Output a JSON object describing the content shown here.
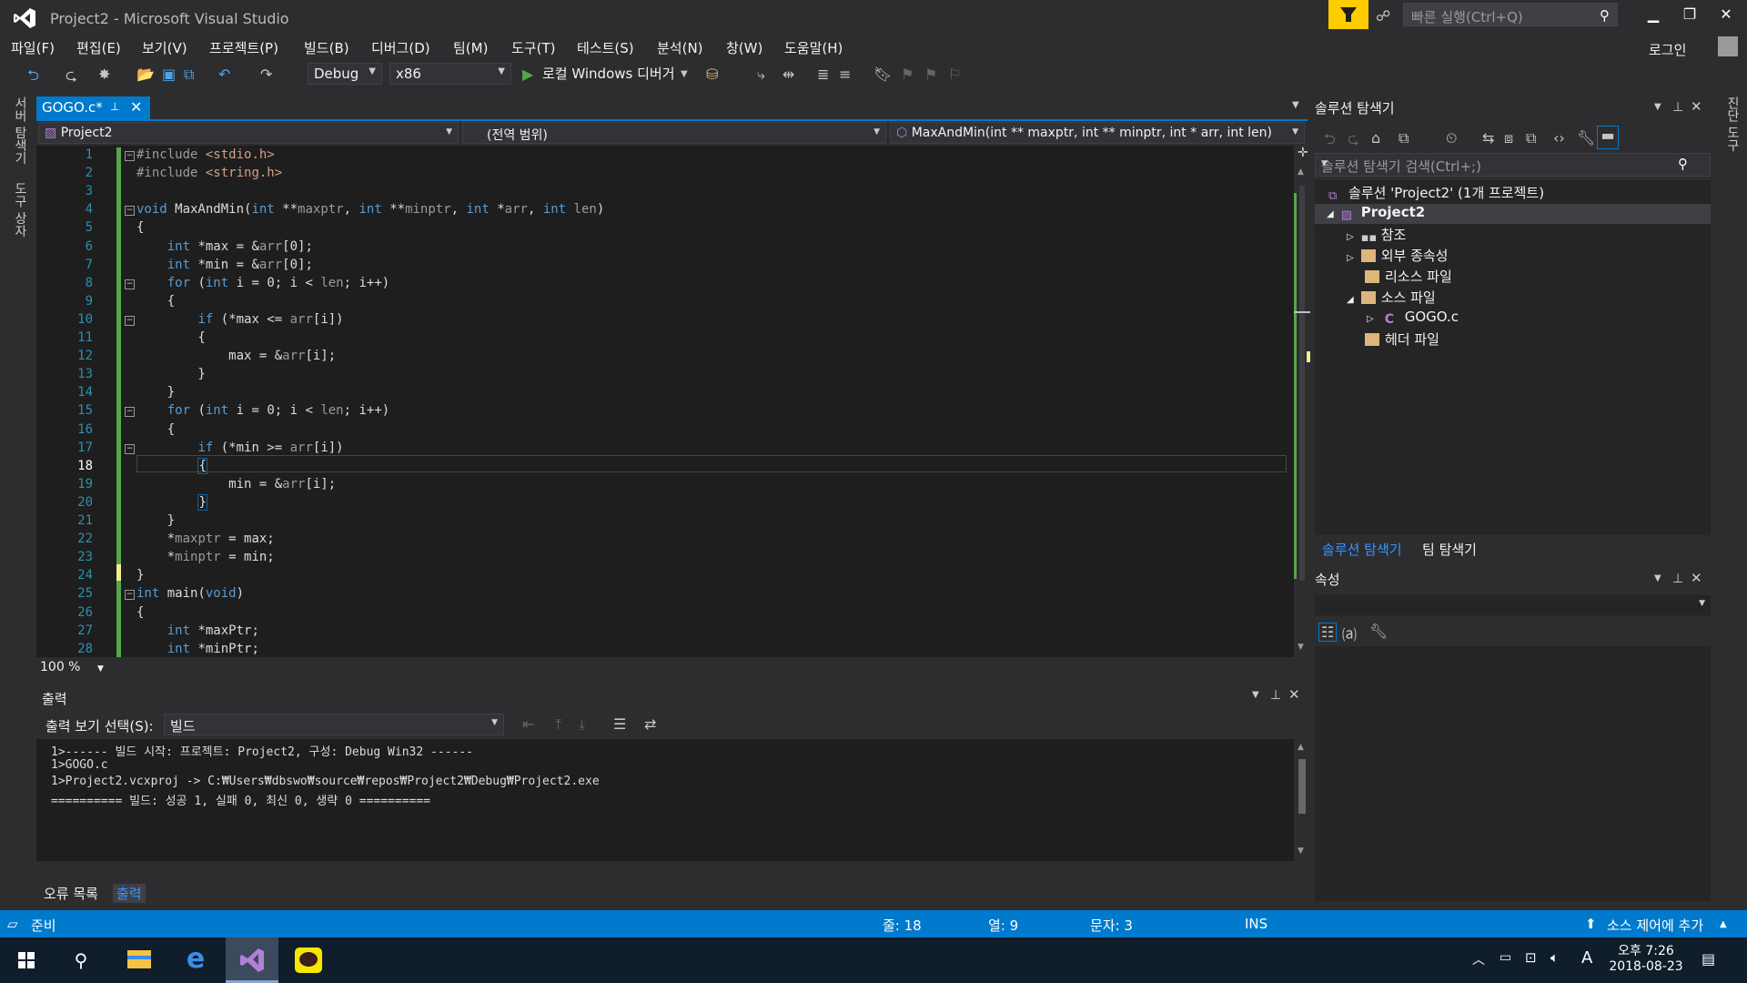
{
  "window": {
    "title": "Project2 - Microsoft Visual Studio",
    "quick_launch_placeholder": "빠른 실행(Ctrl+Q)",
    "login": "로그인"
  },
  "menu": [
    "파일(F)",
    "편집(E)",
    "보기(V)",
    "프로젝트(P)",
    "빌드(B)",
    "디버그(D)",
    "팀(M)",
    "도구(T)",
    "테스트(S)",
    "분석(N)",
    "창(W)",
    "도움말(H)"
  ],
  "toolbar": {
    "config": "Debug",
    "platform": "x86",
    "run_label": "로컬 Windows 디버거"
  },
  "left_strip": [
    "서버 탐색기",
    "도구 상자"
  ],
  "right_strip": [
    "진단 도구"
  ],
  "editor": {
    "tab_label": "GOGO.c*",
    "nav_project": "Project2",
    "nav_scope": "(전역 범위)",
    "nav_member": "MaxAndMin(int ** maxptr, int ** minptr, int * arr, int len)",
    "zoom": "100 %",
    "lines": [
      {
        "n": "1",
        "html": "<span class='inc'>#include</span> <span class='str'>&lt;stdio.h&gt;</span>"
      },
      {
        "n": "2",
        "html": "<span class='inc'>#include</span> <span class='str'>&lt;string.h&gt;</span>"
      },
      {
        "n": "3",
        "html": ""
      },
      {
        "n": "4",
        "html": "<span class='kw'>void</span> MaxAndMin(<span class='kw'>int</span> **<span class='prm'>maxptr</span>, <span class='kw'>int</span> **<span class='prm'>minptr</span>, <span class='kw'>int</span> *<span class='prm'>arr</span>, <span class='kw'>int</span> <span class='prm'>len</span>)"
      },
      {
        "n": "5",
        "html": "{"
      },
      {
        "n": "6",
        "html": "    <span class='kw'>int</span> *max = &amp;<span class='prm'>arr</span>[0];"
      },
      {
        "n": "7",
        "html": "    <span class='kw'>int</span> *min = &amp;<span class='prm'>arr</span>[0];"
      },
      {
        "n": "8",
        "html": "    <span class='kw'>for</span> (<span class='kw'>int</span> i = 0; i &lt; <span class='prm'>len</span>; i++)"
      },
      {
        "n": "9",
        "html": "    {"
      },
      {
        "n": "10",
        "html": "        <span class='kw'>if</span> (*max &lt;= <span class='prm'>arr</span>[i])"
      },
      {
        "n": "11",
        "html": "        {"
      },
      {
        "n": "12",
        "html": "            max = &amp;<span class='prm'>arr</span>[i];"
      },
      {
        "n": "13",
        "html": "        }"
      },
      {
        "n": "14",
        "html": "    }"
      },
      {
        "n": "15",
        "html": "    <span class='kw'>for</span> (<span class='kw'>int</span> i = 0; i &lt; <span class='prm'>len</span>; i++)"
      },
      {
        "n": "16",
        "html": "    {"
      },
      {
        "n": "17",
        "html": "        <span class='kw'>if</span> (*min &gt;= <span class='prm'>arr</span>[i])"
      },
      {
        "n": "18",
        "html": "        <span style='border:1px solid #0e639c'>{</span>"
      },
      {
        "n": "19",
        "html": "            min = &amp;<span class='prm'>arr</span>[i];"
      },
      {
        "n": "20",
        "html": "        <span style='border:1px solid #0e639c'>}</span>"
      },
      {
        "n": "21",
        "html": "    }"
      },
      {
        "n": "22",
        "html": "    *<span class='prm'>maxptr</span> = max;"
      },
      {
        "n": "23",
        "html": "    *<span class='prm'>minptr</span> = min;"
      },
      {
        "n": "24",
        "html": "}"
      },
      {
        "n": "25",
        "html": "<span class='kw'>int</span> main(<span class='kw'>void</span>)"
      },
      {
        "n": "26",
        "html": "{"
      },
      {
        "n": "27",
        "html": "    <span class='kw'>int</span> *maxPtr;"
      },
      {
        "n": "28",
        "html": "    <span class='kw'>int</span> *minPtr;"
      }
    ]
  },
  "output": {
    "title": "출력",
    "selector_label": "출력 보기 선택(S):",
    "selector_value": "빌드",
    "lines": [
      "1>------ 빌드 시작: 프로젝트: Project2, 구성: Debug Win32 ------",
      "1>GOGO.c",
      "1>Project2.vcxproj -> C:₩Users₩dbswo₩source₩repos₩Project2₩Debug₩Project2.exe",
      "========== 빌드: 성공 1, 실패 0, 최신 0, 생략 0 =========="
    ]
  },
  "bottom_tabs": [
    "오류 목록",
    "출력"
  ],
  "solution_explorer": {
    "title": "솔루션 탐색기",
    "search_placeholder": "솔루션 탐색기 검색(Ctrl+;)",
    "tree": [
      {
        "label": "솔루션 'Project2' (1개 프로젝트)",
        "icon": "solution-icon"
      },
      {
        "label": "Project2",
        "icon": "project-icon"
      },
      {
        "label": "참조",
        "icon": "references-icon"
      },
      {
        "label": "외부 종속성",
        "icon": "folder-icon"
      },
      {
        "label": "리소스 파일",
        "icon": "folder-icon"
      },
      {
        "label": "소스 파일",
        "icon": "folder-open-icon"
      },
      {
        "label": "GOGO.c",
        "icon": "c-file-icon"
      },
      {
        "label": "헤더 파일",
        "icon": "folder-icon"
      }
    ],
    "tabs": [
      "솔루션 탐색기",
      "팀 탐색기"
    ]
  },
  "properties": {
    "title": "속성"
  },
  "status": {
    "ready": "준비",
    "line": "줄: 18",
    "col": "열: 9",
    "char": "문자: 3",
    "ins": "INS",
    "source_control": "소스 제어에 추가"
  },
  "taskbar": {
    "time": "오후 7:26",
    "date": "2018-08-23",
    "ime": "A"
  },
  "colors": {
    "accent": "#007acc",
    "keyword": "#569cd6",
    "string": "#d69d85",
    "background": "#2d2d30",
    "editor_bg": "#1e1e1e"
  }
}
